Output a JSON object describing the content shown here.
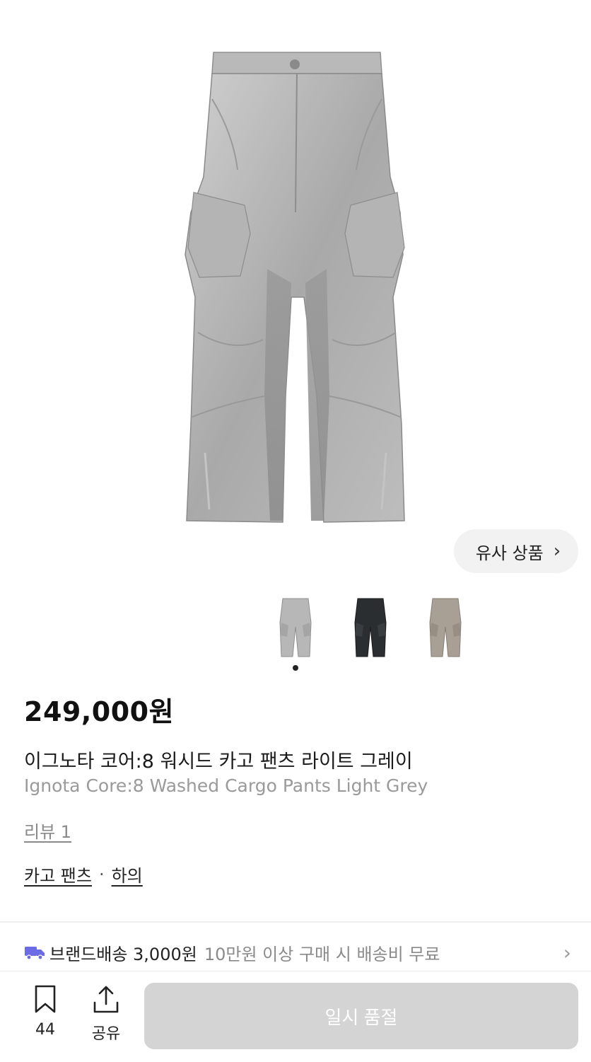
{
  "product": {
    "price": "249,000원",
    "name_ko": "이그노타 코어:8 워시드 카고 팬츠 라이트 그레이",
    "name_en": "Ignota Core:8 Washed Cargo Pants Light Grey",
    "review": "리뷰 1",
    "categories": [
      "카고 팬츠",
      "하의"
    ],
    "category_separator": "·"
  },
  "gallery": {
    "similar_button": "유사 상품",
    "thumbnails": [
      {
        "color": "#b7b7b7",
        "name": "light-grey"
      },
      {
        "color": "#2b2e30",
        "name": "black"
      },
      {
        "color": "#a89f95",
        "name": "beige"
      }
    ],
    "active_index": 0
  },
  "shipping": {
    "label": "브랜드배송 3,000원",
    "note": "10만원 이상 구매 시 배송비 무료",
    "icon": "truck-icon",
    "icon_color": "#6b6be6"
  },
  "bottom_bar": {
    "bookmark_count": "44",
    "share_label": "공유",
    "action_label": "일시 품절",
    "action_color": "#d4d4d4"
  }
}
